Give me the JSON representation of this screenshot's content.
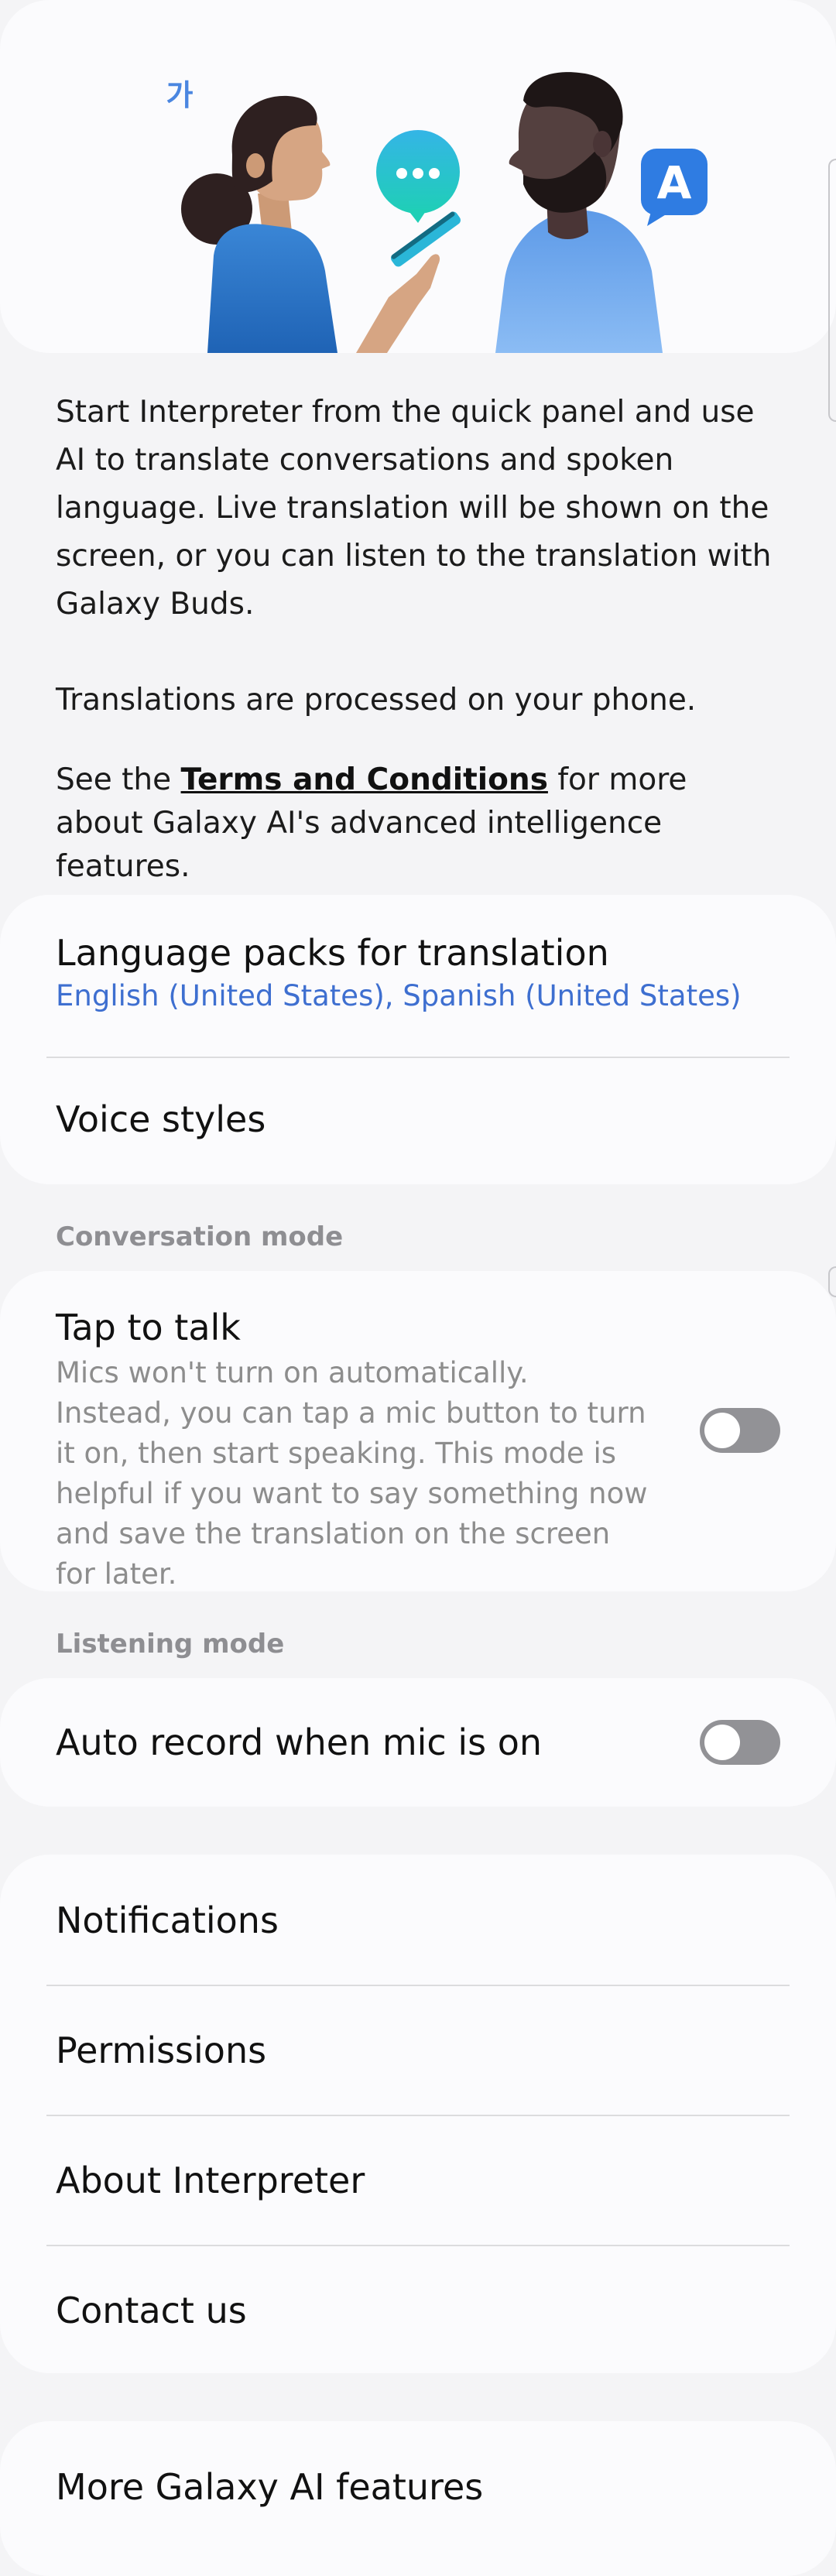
{
  "hero": {
    "ko_badge": "가",
    "a_badge": "A"
  },
  "description": {
    "paragraph1": "Start Interpreter from the quick panel and use AI to translate conversations and spoken language. Live translation will be shown on the screen, or you can listen to the translation with Galaxy Buds.",
    "paragraph2": "Translations are processed on your phone.",
    "paragraph3_prefix": "See the ",
    "paragraph3_link": "Terms and Conditions",
    "paragraph3_suffix": " for more about Galaxy AI's advanced intelligence features."
  },
  "language_card": {
    "language_packs_title": "Language packs for translation",
    "language_packs_value": "English (United States), Spanish (United States)",
    "voice_styles_title": "Voice styles"
  },
  "conversation_mode": {
    "header": "Conversation mode",
    "tap_to_talk_title": "Tap to talk",
    "tap_to_talk_desc": "Mics won't turn on automatically. Instead, you can tap a mic button to turn it on, then start speaking. This mode is helpful if you want to say something now and save the translation on the screen for later.",
    "tap_to_talk_enabled": false
  },
  "listening_mode": {
    "header": "Listening mode",
    "auto_record_title": "Auto record when mic is on",
    "auto_record_enabled": false
  },
  "menu": {
    "items": [
      {
        "label": "Notifications"
      },
      {
        "label": "Permissions"
      },
      {
        "label": "About Interpreter"
      },
      {
        "label": "Contact us"
      }
    ]
  },
  "more": {
    "label": "More Galaxy AI features"
  },
  "colors": {
    "background": "#f4f4f6",
    "card": "#fbfbfd",
    "accent_blue": "#3e6fd0",
    "secondary_text": "#8d8d8d",
    "toggle_off": "#929296"
  }
}
